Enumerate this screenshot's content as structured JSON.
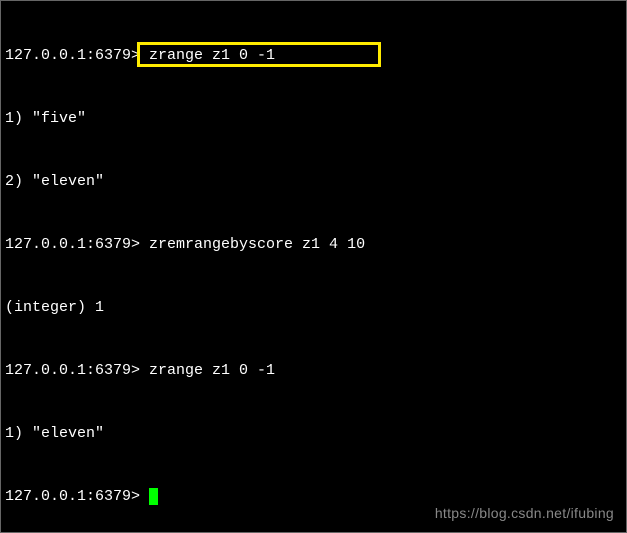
{
  "terminal": {
    "prompt": "127.0.0.1:6379>",
    "lines": [
      {
        "prompt": "127.0.0.1:6379>",
        "cmd": " zrange z1 0 -1"
      },
      {
        "output": "1) \"five\""
      },
      {
        "output": "2) \"eleven\""
      },
      {
        "prompt": "127.0.0.1:6379>",
        "cmd": " zremrangebyscore z1 4 10"
      },
      {
        "output": "(integer) 1"
      },
      {
        "prompt": "127.0.0.1:6379>",
        "cmd": " zrange z1 0 -1"
      },
      {
        "output": "1) \"eleven\""
      },
      {
        "prompt": "127.0.0.1:6379> ",
        "cursor": true
      }
    ]
  },
  "watermark": "https://blog.csdn.net/ifubing"
}
